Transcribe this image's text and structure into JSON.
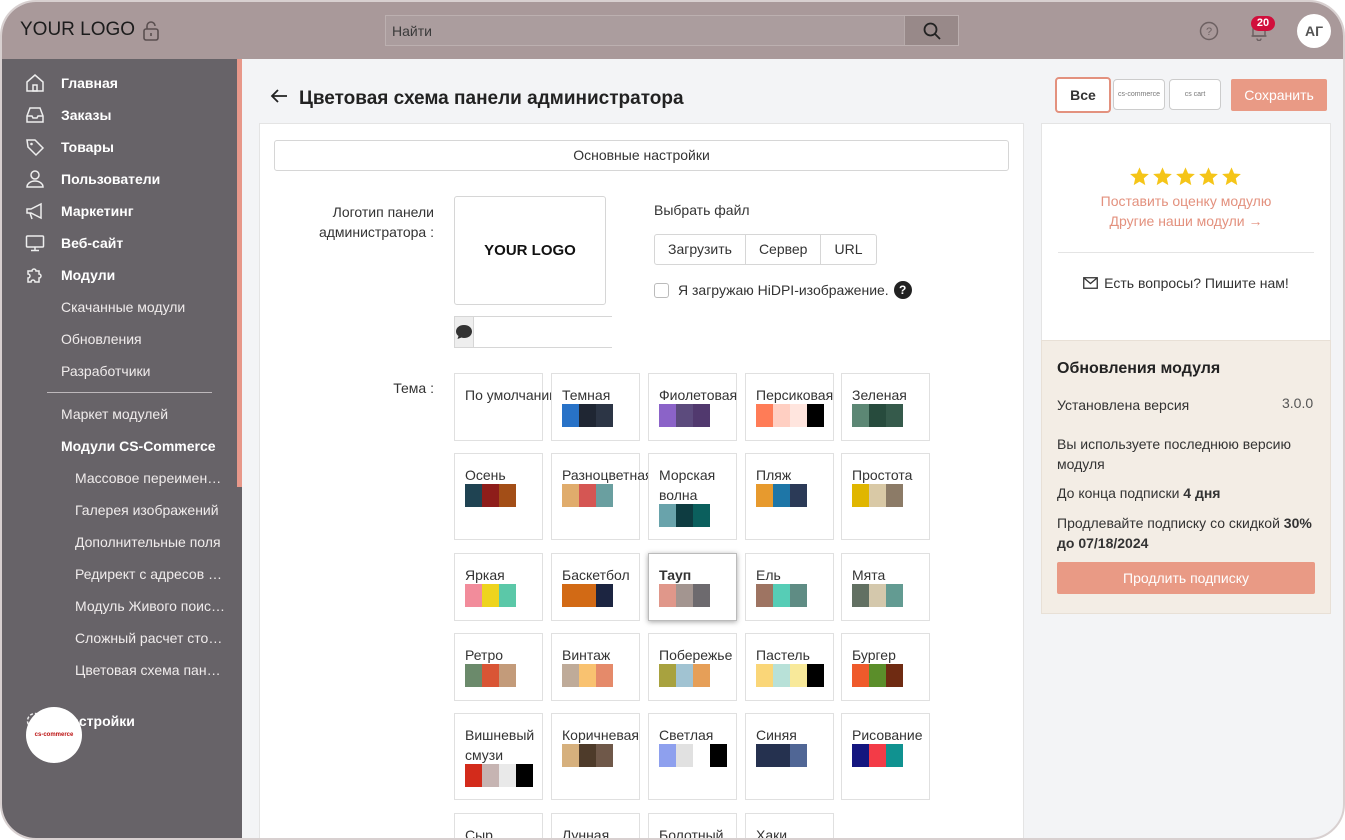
{
  "header": {
    "logo": "YOUR LOGO",
    "search_placeholder": "Найти",
    "notifications_count": "20",
    "avatar_initials": "АГ"
  },
  "sidebar": {
    "items": [
      {
        "label": "Главная",
        "icon": "home-icon"
      },
      {
        "label": "Заказы",
        "icon": "inbox-icon"
      },
      {
        "label": "Товары",
        "icon": "tag-icon"
      },
      {
        "label": "Пользователи",
        "icon": "user-icon"
      },
      {
        "label": "Маркетинг",
        "icon": "megaphone-icon"
      },
      {
        "label": "Веб-сайт",
        "icon": "monitor-icon"
      },
      {
        "label": "Модули",
        "icon": "puzzle-icon"
      }
    ],
    "modules_sub": [
      "Скачанные модули",
      "Обновления",
      "Разработчики"
    ],
    "market": "Маркет модулей",
    "cs_modules": "Модули CS-Commerce",
    "cs_sub": [
      "Массовое переименование",
      "Галерея изображений",
      "Дополнительные поля",
      "Редирект с адресов удаленных",
      "Модуль Живого поиска",
      "Сложный расчет стоимости",
      "Цветовая схема панели"
    ],
    "settings": "Настройки",
    "badge_text": "cs-commerce"
  },
  "page": {
    "title": "Цветовая схема панели администратора",
    "btn_all": "Все",
    "btn_cs_commerce": "cs-commerce",
    "btn_cs_cart": "cs cart",
    "btn_save": "Сохранить",
    "tab_general": "Основные настройки",
    "logo_label": "Логотип панели администратора :",
    "logo_preview": "YOUR LOGO",
    "choose_file": "Выбрать файл",
    "file_buttons": [
      "Загрузить",
      "Сервер",
      "URL"
    ],
    "hidpi_label": "Я загружаю HiDPI-изображение.",
    "hidpi_help": "?",
    "theme_label": "Тема :"
  },
  "themes": [
    {
      "name": "По умолчанию",
      "colors": []
    },
    {
      "name": "Темная",
      "colors": [
        "#2872c7",
        "#1f2633",
        "#2c3545"
      ]
    },
    {
      "name": "Фиолетовая",
      "colors": [
        "#8b63c8",
        "#5c4b7d",
        "#51396e"
      ]
    },
    {
      "name": "Персиковая",
      "colors": [
        "#ff7c57",
        "#ffcfc2",
        "#ffe5de",
        "#000000"
      ]
    },
    {
      "name": "Зеленая",
      "colors": [
        "#5c8774",
        "#274b3d",
        "#355a4b"
      ]
    },
    {
      "name": "Осень",
      "colors": [
        "#1f4352",
        "#8e1d1a",
        "#a34e17"
      ]
    },
    {
      "name": "Разноцветная",
      "colors": [
        "#e0ac6c",
        "#d55653",
        "#6a9fa0"
      ]
    },
    {
      "name": "Морская волна",
      "colors": [
        "#69a3ab",
        "#0e3c41",
        "#0b5f5d"
      ]
    },
    {
      "name": "Пляж",
      "colors": [
        "#e79a2e",
        "#1e76a7",
        "#2b3a57"
      ]
    },
    {
      "name": "Простота",
      "colors": [
        "#e0b600",
        "#d9c9a6",
        "#8c7b67"
      ]
    },
    {
      "name": "Яркая",
      "colors": [
        "#f28c9b",
        "#eed41e",
        "#5bc8a8"
      ]
    },
    {
      "name": "Баскетбол",
      "colors": [
        "#d26a15",
        "#d26a15",
        "#1c2541"
      ]
    },
    {
      "name": "Тауп",
      "colors": [
        "#e0978a",
        "#a39590",
        "#6d6a6e"
      ]
    },
    {
      "name": "Ель",
      "colors": [
        "#9e7462",
        "#56cdb6",
        "#5f8c84"
      ]
    },
    {
      "name": "Мята",
      "colors": [
        "#627062",
        "#d4c8ac",
        "#639b92"
      ]
    },
    {
      "name": "Ретро",
      "colors": [
        "#6b8a6b",
        "#d95535",
        "#c39b7a"
      ]
    },
    {
      "name": "Винтаж",
      "colors": [
        "#bfab99",
        "#f9c270",
        "#e58a6a"
      ]
    },
    {
      "name": "Побережье",
      "colors": [
        "#a8a23f",
        "#a1c3d2",
        "#e69f58"
      ]
    },
    {
      "name": "Пастель",
      "colors": [
        "#fad678",
        "#b8e1d8",
        "#f8e99a",
        "#000000"
      ]
    },
    {
      "name": "Бургер",
      "colors": [
        "#ef5a2b",
        "#5b8e2a",
        "#6f2b12"
      ]
    },
    {
      "name": "Вишневый смузи",
      "colors": [
        "#d32b1b",
        "#c6b4b2",
        "#e9e9e9",
        "#000000"
      ]
    },
    {
      "name": "Коричневая",
      "colors": [
        "#d6b07d",
        "#4e3b2a",
        "#6f5849"
      ]
    },
    {
      "name": "Светлая",
      "colors": [
        "#8ea0ee",
        "#e1e1e1",
        "#ffffff",
        "#000000"
      ]
    },
    {
      "name": "Синяя",
      "colors": [
        "#25314f",
        "#25314f",
        "#506695"
      ]
    },
    {
      "name": "Рисование",
      "colors": [
        "#14167f",
        "#f33b47",
        "#109290"
      ]
    },
    {
      "name": "Сыр,",
      "colors": []
    },
    {
      "name": "Лунная",
      "colors": []
    },
    {
      "name": "Болотный",
      "colors": []
    },
    {
      "name": "Хаки",
      "colors": []
    }
  ],
  "selected_theme": "Тауп",
  "review": {
    "stars": 5,
    "rate_link": "Поставить оценку модулю",
    "other_link": "Другие наши модули →",
    "questions": "Есть вопросы? Пишите нам!"
  },
  "updates": {
    "title": "Обновления модуля",
    "installed_label": "Установлена версия",
    "installed_version": "3.0.0",
    "latest_text": "Вы используете последнюю версию модуля",
    "subscription_prefix": "До конца подписки ",
    "subscription_days": "4 дня",
    "discount_prefix": "Продлевайте подписку со скидкой ",
    "discount_value": "30% до 07/18/2024",
    "renew_button": "Продлить подписку"
  },
  "colors": {
    "accent": "#e99a85",
    "sidebar_bg": "#676368",
    "topbar_bg": "#a9999a",
    "star": "#f5c518"
  }
}
